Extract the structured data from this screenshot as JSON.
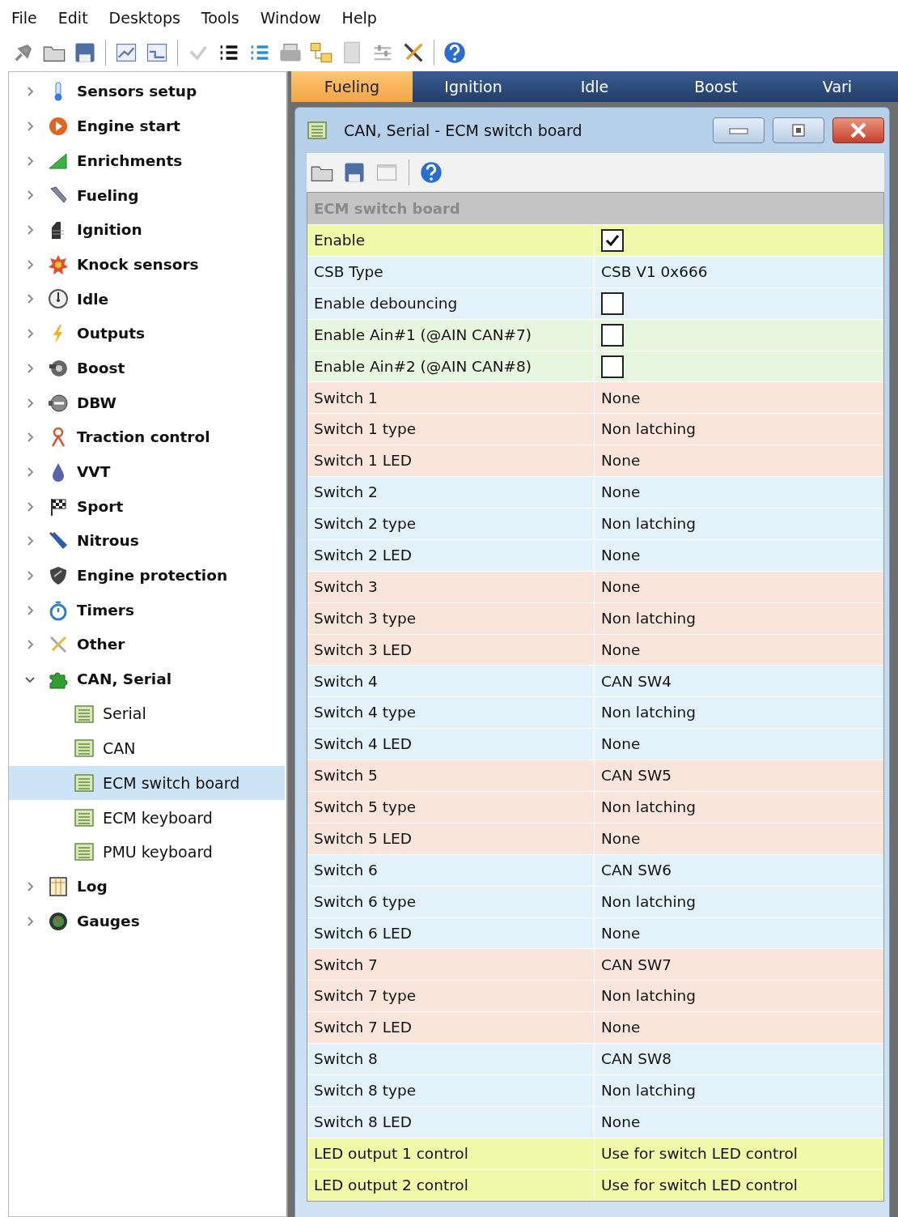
{
  "menu": [
    "File",
    "Edit",
    "Desktops",
    "Tools",
    "Window",
    "Help"
  ],
  "sidebar": {
    "items": [
      {
        "label": "Sensors setup",
        "expanded": false
      },
      {
        "label": "Engine start",
        "expanded": false
      },
      {
        "label": "Enrichments",
        "expanded": false
      },
      {
        "label": "Fueling",
        "expanded": false
      },
      {
        "label": "Ignition",
        "expanded": false
      },
      {
        "label": "Knock sensors",
        "expanded": false
      },
      {
        "label": "Idle",
        "expanded": false
      },
      {
        "label": "Outputs",
        "expanded": false
      },
      {
        "label": "Boost",
        "expanded": false
      },
      {
        "label": "DBW",
        "expanded": false
      },
      {
        "label": "Traction control",
        "expanded": false
      },
      {
        "label": "VVT",
        "expanded": false
      },
      {
        "label": "Sport",
        "expanded": false
      },
      {
        "label": "Nitrous",
        "expanded": false
      },
      {
        "label": "Engine protection",
        "expanded": false
      },
      {
        "label": "Timers",
        "expanded": false
      },
      {
        "label": "Other",
        "expanded": false
      },
      {
        "label": "CAN, Serial",
        "expanded": true,
        "children": [
          {
            "label": "Serial",
            "selected": false
          },
          {
            "label": "CAN",
            "selected": false
          },
          {
            "label": "ECM switch board",
            "selected": true
          },
          {
            "label": "ECM keyboard",
            "selected": false
          },
          {
            "label": "PMU keyboard",
            "selected": false
          }
        ]
      },
      {
        "label": "Log",
        "expanded": false
      },
      {
        "label": "Gauges",
        "expanded": false
      }
    ]
  },
  "tabs": [
    {
      "label": "Fueling",
      "selected": true
    },
    {
      "label": "Ignition",
      "selected": false
    },
    {
      "label": "Idle",
      "selected": false
    },
    {
      "label": "Boost",
      "selected": false
    },
    {
      "label": "Vari",
      "selected": false
    }
  ],
  "window": {
    "title": "CAN, Serial - ECM switch board"
  },
  "table": {
    "section": "ECM switch board",
    "rows": [
      {
        "label": "Enable",
        "kind": "checkbox",
        "checked": true,
        "color": "#f0f9a8"
      },
      {
        "label": "CSB Type",
        "kind": "text",
        "value": "CSB V1 0x666",
        "color": "#e3f1fa"
      },
      {
        "label": "Enable debouncing",
        "kind": "checkbox",
        "checked": false,
        "color": "#e3f1fa"
      },
      {
        "label": "Enable Ain#1 (@AIN CAN#7)",
        "kind": "checkbox",
        "checked": false,
        "color": "#e7f6de"
      },
      {
        "label": "Enable Ain#2 (@AIN CAN#8)",
        "kind": "checkbox",
        "checked": false,
        "color": "#e7f6de"
      },
      {
        "label": "Switch 1",
        "kind": "text",
        "value": "None",
        "color": "#fae5dc"
      },
      {
        "label": "Switch 1 type",
        "kind": "text",
        "value": "Non latching",
        "color": "#fae5dc"
      },
      {
        "label": "Switch 1 LED",
        "kind": "text",
        "value": "None",
        "color": "#fae5dc"
      },
      {
        "label": "Switch 2",
        "kind": "text",
        "value": "None",
        "color": "#e3f1fa"
      },
      {
        "label": "Switch 2 type",
        "kind": "text",
        "value": "Non latching",
        "color": "#e3f1fa"
      },
      {
        "label": "Switch 2 LED",
        "kind": "text",
        "value": "None",
        "color": "#e3f1fa"
      },
      {
        "label": "Switch 3",
        "kind": "text",
        "value": "None",
        "color": "#fae5dc"
      },
      {
        "label": "Switch 3 type",
        "kind": "text",
        "value": "Non latching",
        "color": "#fae5dc"
      },
      {
        "label": "Switch 3 LED",
        "kind": "text",
        "value": "None",
        "color": "#fae5dc"
      },
      {
        "label": "Switch 4",
        "kind": "text",
        "value": "CAN SW4",
        "color": "#e3f1fa"
      },
      {
        "label": "Switch 4 type",
        "kind": "text",
        "value": "Non latching",
        "color": "#e3f1fa"
      },
      {
        "label": "Switch 4 LED",
        "kind": "text",
        "value": "None",
        "color": "#e3f1fa"
      },
      {
        "label": "Switch 5",
        "kind": "text",
        "value": "CAN SW5",
        "color": "#fae5dc"
      },
      {
        "label": "Switch 5 type",
        "kind": "text",
        "value": "Non latching",
        "color": "#fae5dc"
      },
      {
        "label": "Switch 5 LED",
        "kind": "text",
        "value": "None",
        "color": "#fae5dc"
      },
      {
        "label": "Switch 6",
        "kind": "text",
        "value": "CAN SW6",
        "color": "#e3f1fa"
      },
      {
        "label": "Switch 6 type",
        "kind": "text",
        "value": "Non latching",
        "color": "#e3f1fa"
      },
      {
        "label": "Switch 6 LED",
        "kind": "text",
        "value": "None",
        "color": "#e3f1fa"
      },
      {
        "label": "Switch 7",
        "kind": "text",
        "value": "CAN SW7",
        "color": "#fae5dc"
      },
      {
        "label": "Switch 7 type",
        "kind": "text",
        "value": "Non latching",
        "color": "#fae5dc"
      },
      {
        "label": "Switch 7 LED",
        "kind": "text",
        "value": "None",
        "color": "#fae5dc"
      },
      {
        "label": "Switch 8",
        "kind": "text",
        "value": "CAN SW8",
        "color": "#e3f1fa"
      },
      {
        "label": "Switch 8 type",
        "kind": "text",
        "value": "Non latching",
        "color": "#e3f1fa"
      },
      {
        "label": "Switch 8 LED",
        "kind": "text",
        "value": "None",
        "color": "#e3f1fa"
      },
      {
        "label": "LED output 1 control",
        "kind": "text",
        "value": "Use for switch LED control",
        "color": "#f0f9a8"
      },
      {
        "label": "LED output 2 control",
        "kind": "text",
        "value": "Use for switch LED control",
        "color": "#f0f9a8"
      }
    ]
  }
}
